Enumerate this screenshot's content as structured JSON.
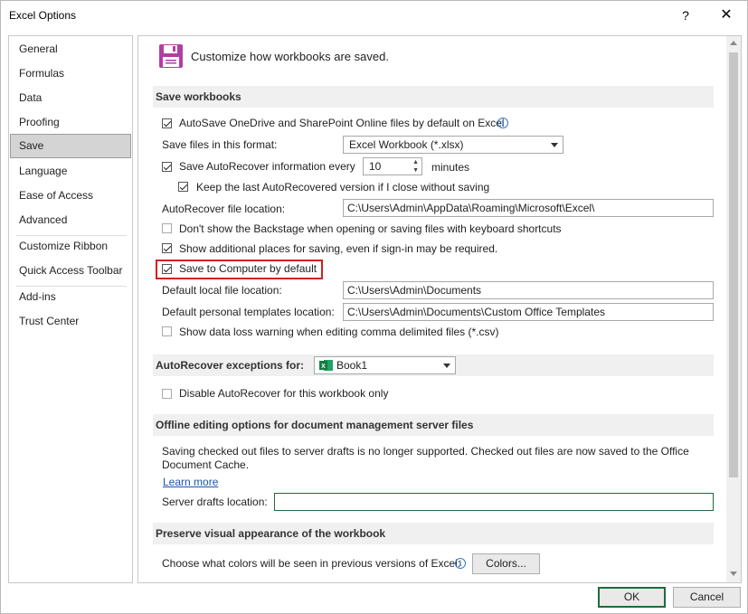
{
  "window": {
    "title": "Excel Options",
    "help_glyph": "?",
    "close_glyph": "✕"
  },
  "nav": {
    "items": [
      {
        "label": "General"
      },
      {
        "label": "Formulas"
      },
      {
        "label": "Data"
      },
      {
        "label": "Proofing"
      },
      {
        "label": "Save",
        "active": true
      },
      {
        "label": "Language"
      },
      {
        "label": "Ease of Access"
      },
      {
        "label": "Advanced"
      },
      {
        "label": "Customize Ribbon"
      },
      {
        "label": "Quick Access Toolbar"
      },
      {
        "label": "Add-ins"
      },
      {
        "label": "Trust Center"
      }
    ]
  },
  "header": {
    "icon": "floppy-disk-icon",
    "icon_color": "#b13ea1",
    "text": "Customize how workbooks are saved."
  },
  "save_workbooks": {
    "title": "Save workbooks",
    "autosave_label": "AutoSave OneDrive and SharePoint Online files by default on Excel",
    "autosave_checked": true,
    "format_label": "Save files in this format:",
    "format_value": "Excel Workbook (*.xlsx)",
    "autorecover_label": "Save AutoRecover information every",
    "autorecover_checked": true,
    "autorecover_minutes": "10",
    "minutes_label": "minutes",
    "keep_last_label": "Keep the last AutoRecovered version if I close without saving",
    "keep_last_checked": true,
    "autorecover_location_label": "AutoRecover file location:",
    "autorecover_location_value": "C:\\Users\\Admin\\AppData\\Roaming\\Microsoft\\Excel\\",
    "backstage_label": "Don't show the Backstage when opening or saving files with keyboard shortcuts",
    "backstage_checked": false,
    "additional_places_label": "Show additional places for saving, even if sign-in may be required.",
    "additional_places_checked": true,
    "save_computer_label": "Save to Computer by default",
    "save_computer_checked": true,
    "default_local_label": "Default local file location:",
    "default_local_value": "C:\\Users\\Admin\\Documents",
    "templates_label": "Default personal templates location:",
    "templates_value": "C:\\Users\\Admin\\Documents\\Custom Office Templates",
    "csv_warning_label": "Show data loss warning when editing comma delimited files (*.csv)",
    "csv_warning_checked": false
  },
  "autorecover_exceptions": {
    "title": "AutoRecover exceptions for:",
    "workbook_value": "Book1",
    "workbook_icon": "excel-icon",
    "disable_label": "Disable AutoRecover for this workbook only",
    "disable_checked": false
  },
  "offline": {
    "title": "Offline editing options for document management server files",
    "text_line1": "Saving checked out files to server drafts is no longer supported. Checked out files are now saved to the Office",
    "text_line2": "Document Cache.",
    "learn_more": "Learn more",
    "server_drafts_label": "Server drafts location:",
    "server_drafts_value": ""
  },
  "preserve": {
    "title": "Preserve visual appearance of the workbook",
    "colors_label": "Choose what colors will be seen in previous versions of Excel:",
    "colors_button": "Colors..."
  },
  "footer": {
    "ok": "OK",
    "cancel": "Cancel"
  }
}
